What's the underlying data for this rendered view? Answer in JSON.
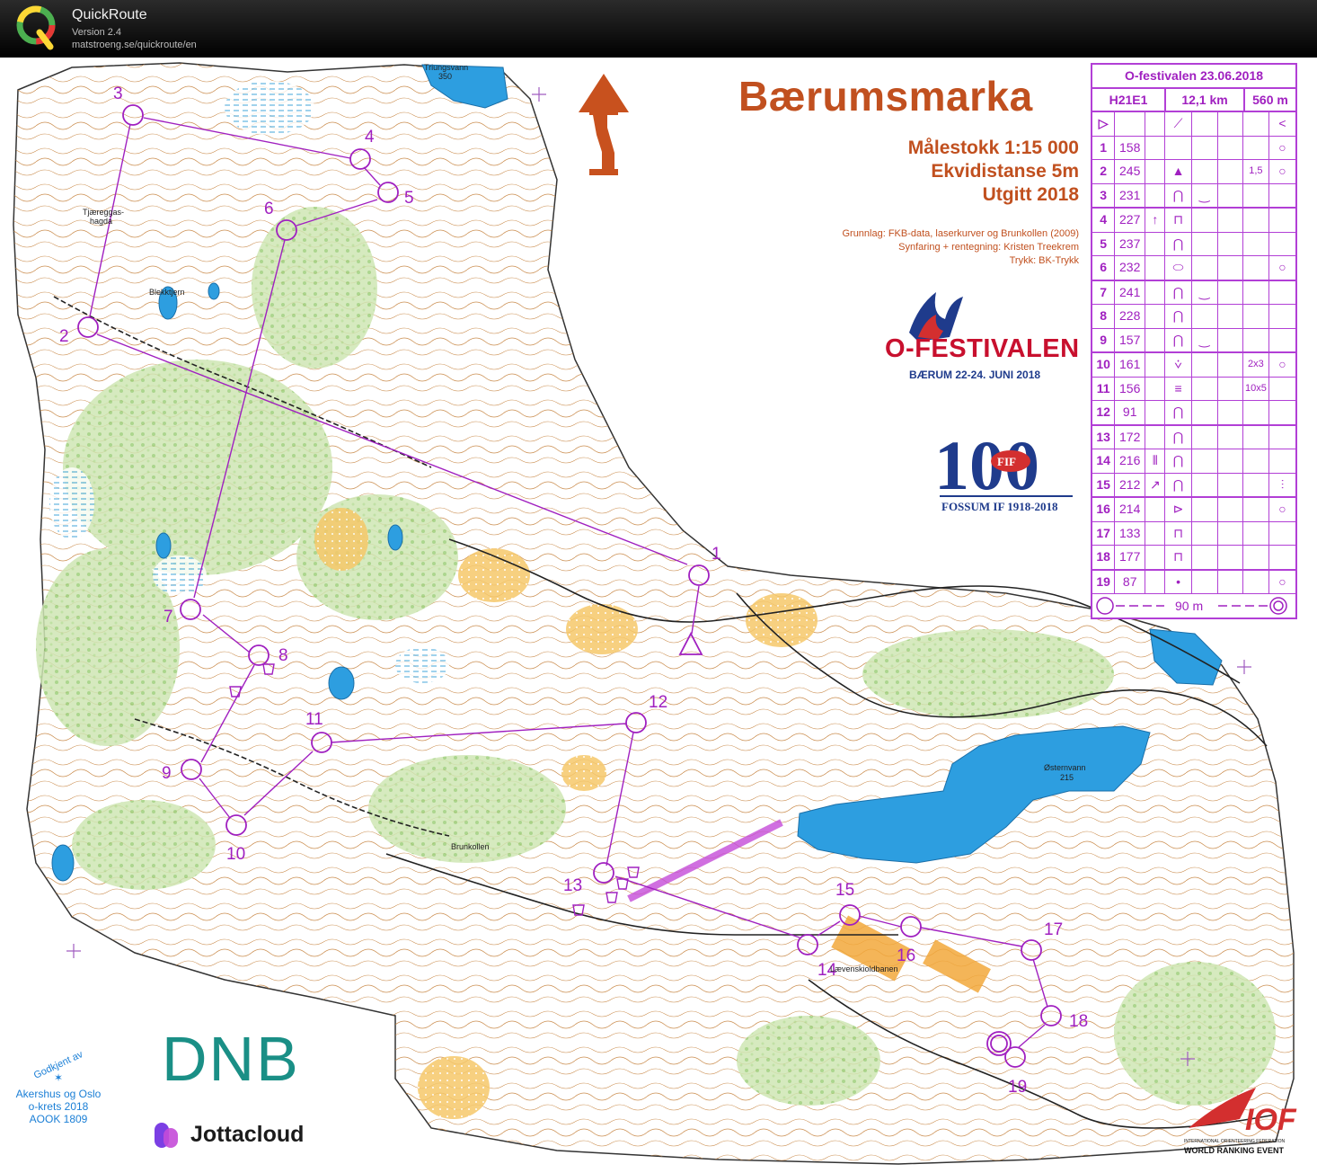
{
  "app": {
    "name": "QuickRoute",
    "version": "Version 2.4",
    "url": "matstroeng.se/quickroute/en"
  },
  "map": {
    "title": "Bærumsmarka",
    "scale": "Målestokk 1:15 000",
    "contour": "Ekvidistanse 5m",
    "published": "Utgitt 2018",
    "credit1": "Grunnlag: FKB-data, laserkurver og Brunkollen (2009)",
    "credit2": "Synfaring + rentegning: Kristen Treekrem",
    "credit3": "Trykk: BK-Trykk",
    "place_names": {
      "triungsvann": "Triungsvann",
      "triungsvann_height": "350",
      "tjaereggs": "Tjæreggas-",
      "tjaereggs2": "hagda",
      "blekktjern": "Blekktjern",
      "ostemvann": "Østernvann",
      "ostemvann_height": "215",
      "brunkollen": "Brunkollen",
      "skjold": "Lævenskioldbanen"
    },
    "controls": [
      {
        "label": "1"
      },
      {
        "label": "2"
      },
      {
        "label": "3"
      },
      {
        "label": "4"
      },
      {
        "label": "5"
      },
      {
        "label": "6"
      },
      {
        "label": "7"
      },
      {
        "label": "8"
      },
      {
        "label": "9"
      },
      {
        "label": "10"
      },
      {
        "label": "11"
      },
      {
        "label": "12"
      },
      {
        "label": "13"
      },
      {
        "label": "14"
      },
      {
        "label": "15"
      },
      {
        "label": "16"
      },
      {
        "label": "17"
      },
      {
        "label": "18"
      },
      {
        "label": "19"
      }
    ],
    "course_color": "#b23fd6"
  },
  "event": {
    "ofest_name": "O-FESTIVALEN",
    "ofest_date": "BÆRUM 22-24. JUNI 2018",
    "fossum_big": "100",
    "fossum_mid": "FIF",
    "fossum_caption": "FOSSUM IF 1918-2018"
  },
  "description": {
    "header": "O-festivalen 23.06.2018",
    "class": "H21E1",
    "length": "12,1 km",
    "climb": "560 m",
    "rows": [
      {
        "n": "1",
        "code": "158",
        "e": "",
        "f": "",
        "g": "",
        "h": ""
      },
      {
        "n": "2",
        "code": "245",
        "e": "",
        "f": "",
        "g": "1,5",
        "h": ""
      },
      {
        "n": "3",
        "code": "231",
        "e": "",
        "f": "",
        "g": "",
        "h": ""
      },
      {
        "n": "4",
        "code": "227",
        "e": "",
        "f": "",
        "g": "",
        "h": ""
      },
      {
        "n": "5",
        "code": "237",
        "e": "",
        "f": "",
        "g": "",
        "h": ""
      },
      {
        "n": "6",
        "code": "232",
        "e": "",
        "f": "",
        "g": "",
        "h": ""
      },
      {
        "n": "7",
        "code": "241",
        "e": "",
        "f": "",
        "g": "",
        "h": ""
      },
      {
        "n": "8",
        "code": "228",
        "e": "",
        "f": "",
        "g": "",
        "h": ""
      },
      {
        "n": "9",
        "code": "157",
        "e": "",
        "f": "",
        "g": "",
        "h": ""
      },
      {
        "n": "10",
        "code": "161",
        "e": "",
        "f": "",
        "g": "2x3",
        "h": ""
      },
      {
        "n": "11",
        "code": "156",
        "e": "",
        "f": "",
        "g": "10x5",
        "h": ""
      },
      {
        "n": "12",
        "code": "91",
        "e": "",
        "f": "",
        "g": "",
        "h": ""
      },
      {
        "n": "13",
        "code": "172",
        "e": "",
        "f": "",
        "g": "",
        "h": ""
      },
      {
        "n": "14",
        "code": "216",
        "e": "",
        "f": "",
        "g": "",
        "h": ""
      },
      {
        "n": "15",
        "code": "212",
        "e": "",
        "f": "",
        "g": "",
        "h": ""
      },
      {
        "n": "16",
        "code": "214",
        "e": "",
        "f": "",
        "g": "",
        "h": ""
      },
      {
        "n": "17",
        "code": "133",
        "e": "",
        "f": "",
        "g": "",
        "h": ""
      },
      {
        "n": "18",
        "code": "177",
        "e": "",
        "f": "",
        "g": "",
        "h": ""
      },
      {
        "n": "19",
        "code": "87",
        "e": "",
        "f": "",
        "g": "",
        "h": ""
      }
    ],
    "finish_distance": "90 m"
  },
  "sponsors": {
    "dnb": "DNB",
    "jotta": "Jottacloud",
    "approved1": "Godkjent av",
    "approved2": "Akershus og Oslo",
    "approved3": "o-krets 2018",
    "approved4": "AOOK 1809",
    "iof_name": "INTERNATIONAL ORIENTEERING FEDERATION",
    "iof_event": "WORLD RANKING EVENT",
    "iof_logo": "IOF"
  }
}
